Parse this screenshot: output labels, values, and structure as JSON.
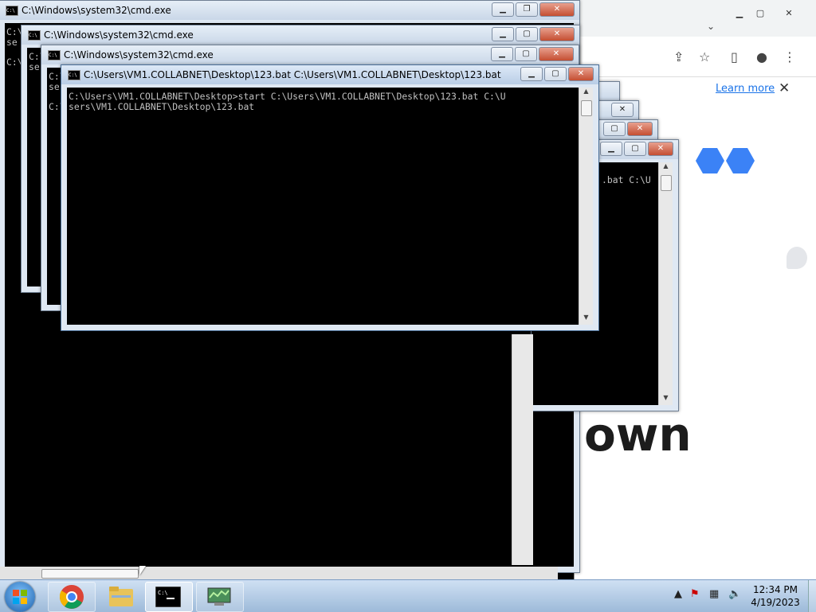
{
  "browser": {
    "learn_more": "Learn more",
    "close_glyph": "✕",
    "big_text": "own",
    "min_glyph": "▁",
    "max_glyph": "▢",
    "close_win_glyph": "✕",
    "chevron_glyph": "⌄",
    "share_glyph": "⇪",
    "star_glyph": "☆",
    "sidepanel_glyph": "▯",
    "profile_glyph": "●",
    "menu_glyph": "⋮"
  },
  "windows": {
    "w1": {
      "title": "C:\\Windows\\system32\\cmd.exe",
      "lines": "C:\\\nse\n\nC:\\"
    },
    "w2": {
      "title": "C:\\Windows\\system32\\cmd.exe",
      "lines": "C:\\\nse"
    },
    "w3": {
      "title": "C:\\Windows\\system32\\cmd.exe",
      "lines": "C:\\\nse\n\nC:\\"
    },
    "w4": {
      "title": "C:\\Users\\VM1.COLLABNET\\Desktop\\123.bat   C:\\Users\\VM1.COLLABNET\\Desktop\\123.bat",
      "lines": "C:\\Users\\VM1.COLLABNET\\Desktop>start C:\\Users\\VM1.COLLABNET\\Desktop\\123.bat C:\\U\nsers\\VM1.COLLABNET\\Desktop\\123.bat"
    },
    "w5": {
      "lines": ".bat C:\\U"
    },
    "controls": {
      "min": "▁",
      "max": "▢",
      "restore": "❐",
      "close": "✕"
    }
  },
  "taskbar": {
    "clock_time": "12:34 PM",
    "clock_date": "4/19/2023",
    "tray_arrow": "▲"
  },
  "colors": {
    "taskbar": "#9dbad9",
    "close_button": "#c44e32",
    "link": "#1a73e8",
    "logo_blue": "#3b82f6"
  }
}
